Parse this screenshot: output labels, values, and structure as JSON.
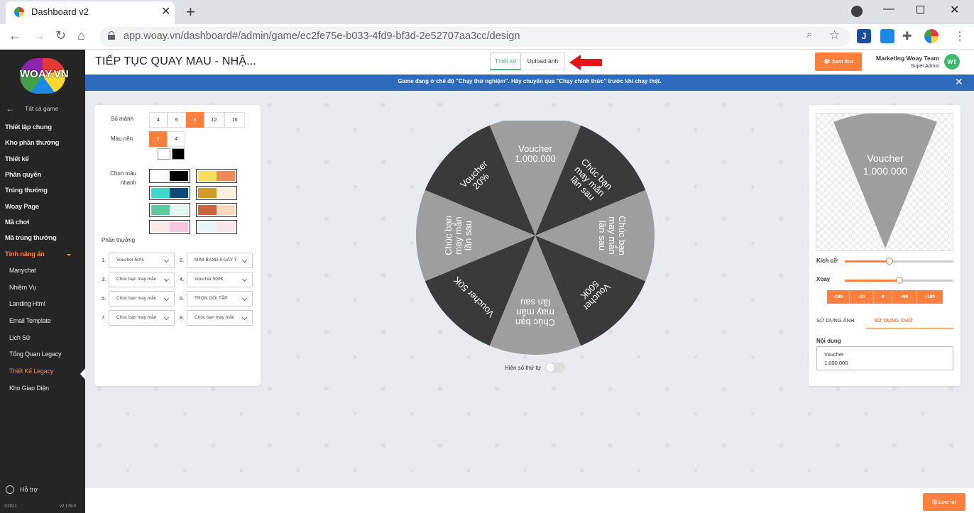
{
  "browser": {
    "tab_title": "Dashboard v2",
    "url": "app.woay.vn/dashboard#/admin/game/ec2fe75e-b033-4fd9-bf3d-2e52707aa3cc/design"
  },
  "sidebar": {
    "logo": "WOAY.VN",
    "back_label": "Tất cả game",
    "items": [
      {
        "label": "Thiết lập chung"
      },
      {
        "label": "Kho phần thưởng"
      },
      {
        "label": "Thiết kế"
      },
      {
        "label": "Phân quyền"
      },
      {
        "label": "Trúng thưởng"
      },
      {
        "label": "Woay Page"
      },
      {
        "label": "Mã chơi"
      },
      {
        "label": "Mã trúng thưởng"
      },
      {
        "label": "Tính năng ẩn"
      }
    ],
    "sub_items": [
      {
        "label": "Manychat"
      },
      {
        "label": "Nhiệm Vụ"
      },
      {
        "label": "Landing Html"
      },
      {
        "label": "Email Template"
      },
      {
        "label": "Lịch Sử"
      },
      {
        "label": "Tổng Quan Legacy"
      },
      {
        "label": "Thiết Kế Legacy"
      },
      {
        "label": "Kho Giao Diện"
      }
    ],
    "help": "Hỗ trợ",
    "copyright": "©2021",
    "version": "v2.178.0"
  },
  "header": {
    "title": "TIẾP TỤC QUAY MAU - NHẬ...",
    "tabs": [
      "Thiết kế",
      "Upload ảnh"
    ],
    "preview_button": "Xem thử",
    "user_name": "Marketing Woay Team",
    "user_role": "Super Admin",
    "avatar_initials": "WT"
  },
  "banner": {
    "text": "Game đang ở chế độ \"Chạy thử nghiệm\". Hãy chuyển qua \"Chạy chính thức\" trước khi chạy thật."
  },
  "left_panel": {
    "pieces_label": "Số mảnh",
    "pieces_options": [
      "4",
      "6",
      "8",
      "12",
      "16"
    ],
    "pieces_selected": "8",
    "bg_color_label": "Màu nền",
    "bg_color_options": [
      "2",
      "4"
    ],
    "bg_color_selected": "2",
    "bg_colors": [
      "#ffffff",
      "#000000"
    ],
    "quick_color_label": "Chọn màu nhanh",
    "quick_palettes": [
      [
        "#ffffff",
        "#000000"
      ],
      [
        "#f7e15c",
        "#f08a5d"
      ],
      [
        "#3ad9c9",
        "#0a4a7a"
      ],
      [
        "#d49a2a",
        "#fdf0dc"
      ],
      [
        "#5fcaa2",
        "#e3f9ef"
      ],
      [
        "#c8643e",
        "#f7dcc0"
      ],
      [
        "#fde8e8",
        "#f7c6e0"
      ],
      [
        "#e8f6f8",
        "#f8e6e8"
      ]
    ],
    "prizes_label": "Phần thưởng",
    "prizes": [
      {
        "num": "1.",
        "value": "Voucher 50%"
      },
      {
        "num": "2.",
        "value": "MINI BAND 6 DÂY T"
      },
      {
        "num": "3.",
        "value": "Chúc bạn may mắn"
      },
      {
        "num": "4.",
        "value": "Voucher 500K"
      },
      {
        "num": "5.",
        "value": "Chúc bạn may mắn"
      },
      {
        "num": "6.",
        "value": "TRỌN GÓI TẬP"
      },
      {
        "num": "7.",
        "value": "Chúc bạn may mắn"
      },
      {
        "num": "8.",
        "value": "Chúc bạn may mắn"
      }
    ]
  },
  "wheel": {
    "dark_color": "#3a3a3a",
    "light_color": "#9e9e9e",
    "segments": [
      {
        "label": "Voucher\n1.000.000",
        "color": "light"
      },
      {
        "label": "Chúc bạn\nmay mắn\nlần sau",
        "color": "dark"
      },
      {
        "label": "Chúc bạn\nmay mắn\nlần sau",
        "color": "light"
      },
      {
        "label": "Voucher\n500K",
        "color": "dark"
      },
      {
        "label": "Chúc bạn\nmay mắn\nlần sau",
        "color": "light"
      },
      {
        "label": "Voucher 50K",
        "color": "dark"
      },
      {
        "label": "Chúc bạn\nmay mắn\nlần sau",
        "color": "light"
      },
      {
        "label": "Voucher\n20%",
        "color": "dark"
      }
    ],
    "show_order_label": "Hiện số thứ tự"
  },
  "right_panel": {
    "preview_text": "Voucher\n1.000.000",
    "size_label": "Kích cỡ",
    "size_value": 0.41,
    "rotate_label": "Xoay",
    "rotate_value": 0.5,
    "rotate_buttons": [
      "-180",
      "-90",
      "0",
      "+90",
      "+180"
    ],
    "tab_image": "SỬ DỤNG ẢNH",
    "tab_text": "SỬ DỤNG CHỮ",
    "content_label": "Nội dung",
    "content_value": "Voucher\n1.000.000"
  },
  "footer": {
    "save_button": "Lưu lại"
  }
}
